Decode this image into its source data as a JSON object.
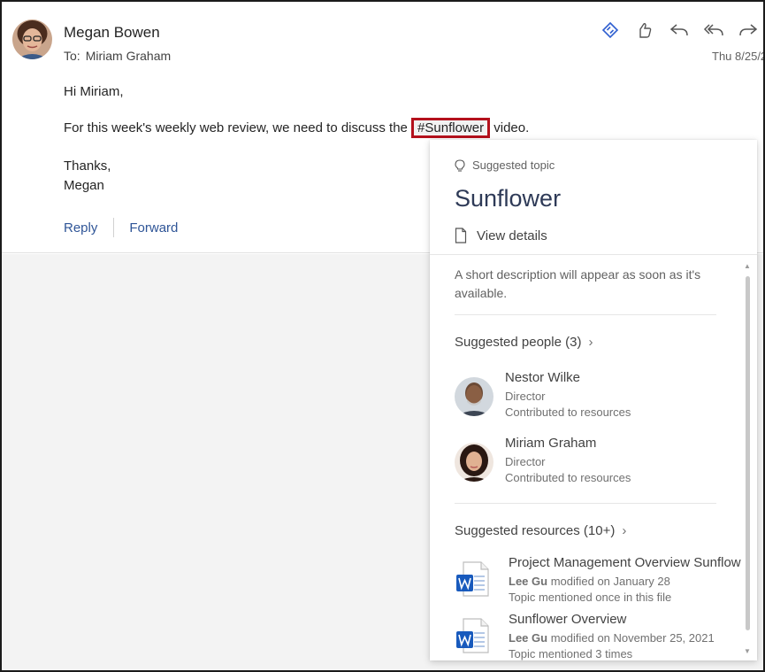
{
  "email": {
    "sender": "Megan Bowen",
    "to_label": "To:",
    "to_name": "Miriam Graham",
    "date": "Thu 8/25/2",
    "greeting": "Hi Miriam,",
    "body_before": "For this week's weekly web review, we need to discuss the ",
    "hashtag": "#Sunflower",
    "body_after": " video.",
    "sign_off": "Thanks,",
    "signature": "Megan",
    "reply_label": "Reply",
    "forward_label": "Forward"
  },
  "toolbar": {
    "icons": [
      "loop-icon",
      "like-icon",
      "reply-icon",
      "reply-all-icon",
      "forward-icon"
    ]
  },
  "card": {
    "suggested_topic_label": "Suggested topic",
    "topic_title": "Sunflower",
    "view_details_label": "View details",
    "description": "A short description will appear as soon as it's available.",
    "people_header": "Suggested people (3)",
    "people": [
      {
        "name": "Nestor Wilke",
        "role": "Director",
        "contribution": "Contributed to resources"
      },
      {
        "name": "Miriam Graham",
        "role": "Director",
        "contribution": "Contributed to resources"
      }
    ],
    "resources_header": "Suggested resources (10+)",
    "resources": [
      {
        "title": "Project Management Overview Sunflow",
        "author": "Lee Gu",
        "modified": "modified on January 28",
        "mention": "Topic mentioned once in this file"
      },
      {
        "title": "Sunflower Overview",
        "author": "Lee Gu",
        "modified": "modified on November 25, 2021",
        "mention": "Topic mentioned 3 times"
      }
    ]
  },
  "colors": {
    "accent": "#2f5597",
    "hashtag_border": "#b4111c",
    "topic_title": "#2e3a57",
    "word_blue": "#185abd"
  }
}
